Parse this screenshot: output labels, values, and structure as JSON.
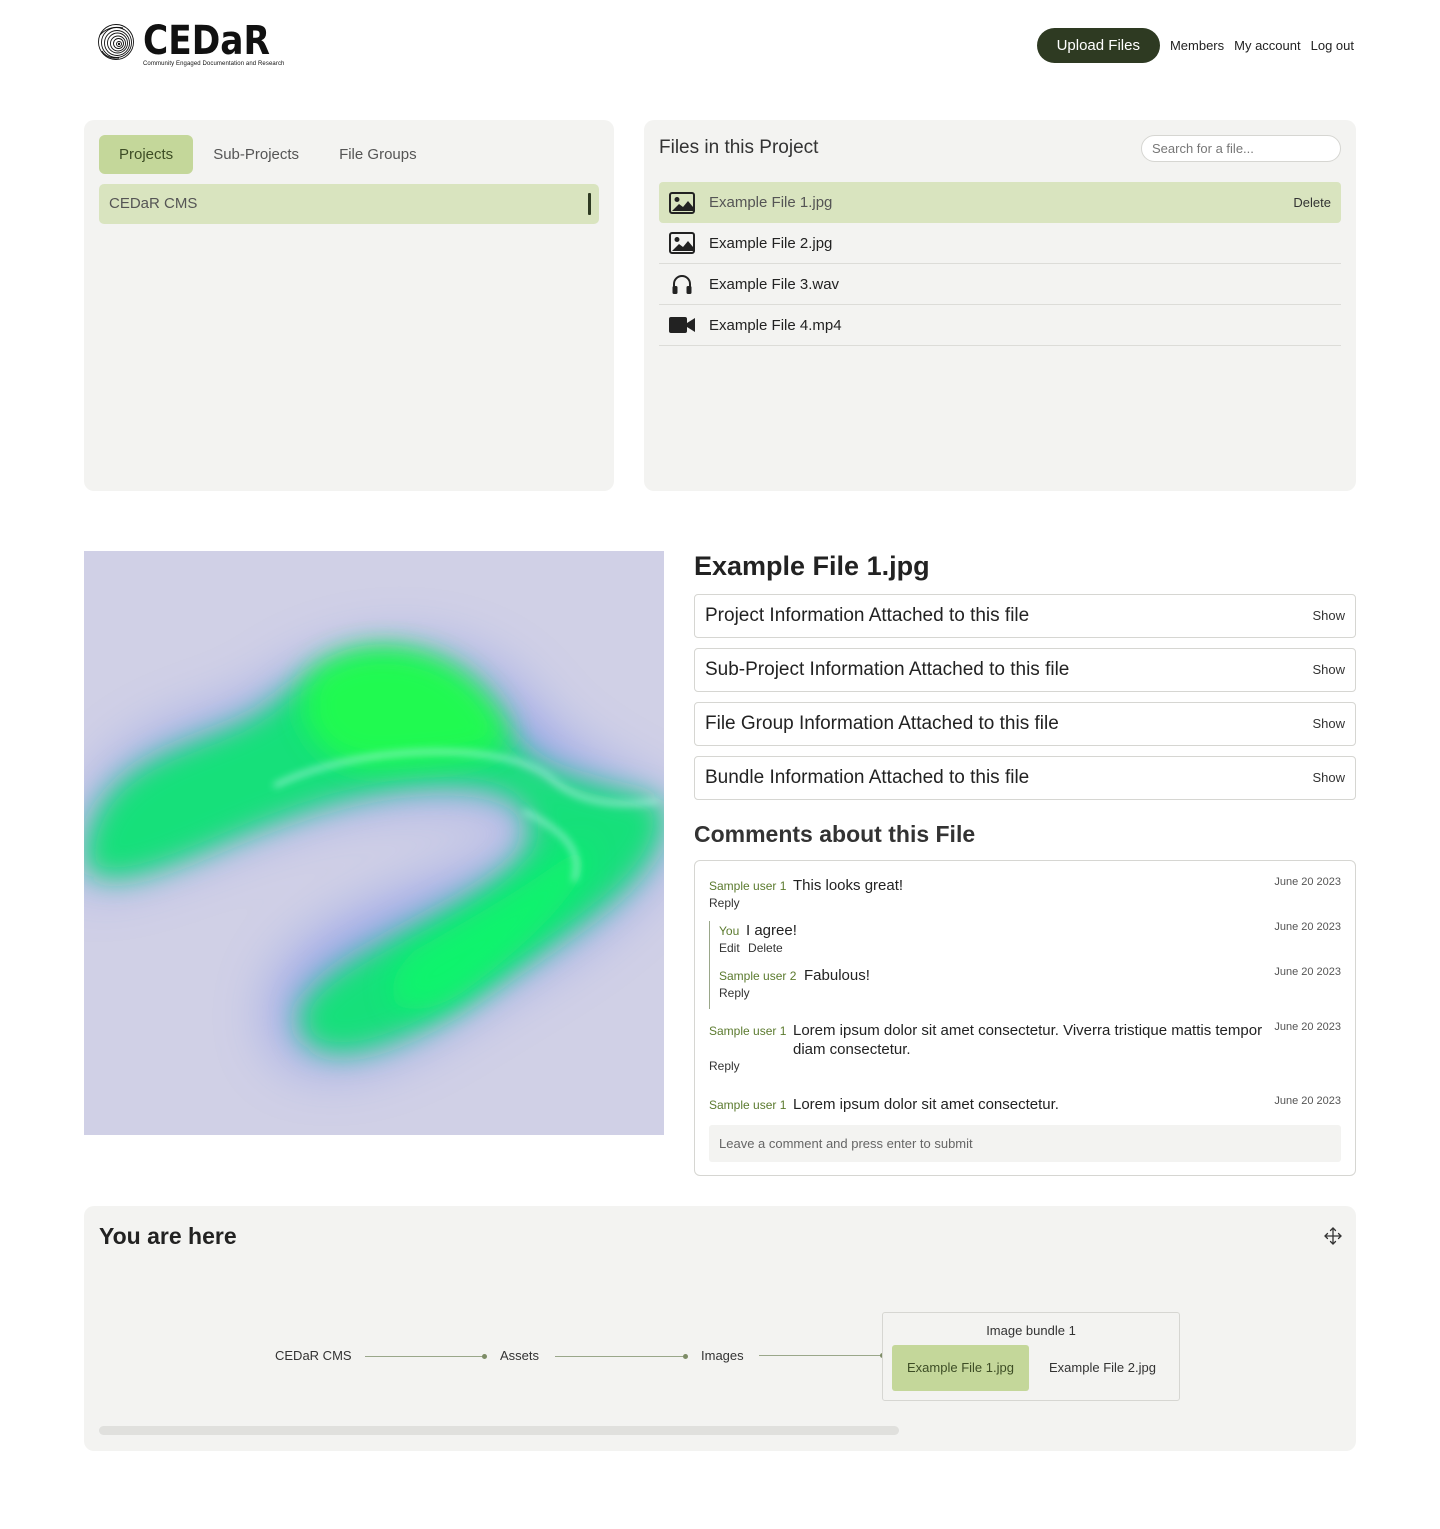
{
  "brand": {
    "name": "CEDaR",
    "tagline": "Community Engaged Documentation and Research",
    "logo_icon": "fingerprint-spiral-icon"
  },
  "nav": {
    "upload_label": "Upload Files",
    "links": [
      "Members",
      "My account",
      "Log out"
    ]
  },
  "left_panel": {
    "tabs": [
      "Projects",
      "Sub-Projects",
      "File Groups"
    ],
    "active_tab": "Projects",
    "projects": [
      "CEDaR CMS"
    ]
  },
  "files_panel": {
    "title": "Files in this Project",
    "search_placeholder": "Search for a file...",
    "delete_label": "Delete",
    "files": [
      {
        "name": "Example File 1.jpg",
        "icon": "image-icon",
        "selected": true
      },
      {
        "name": "Example File 2.jpg",
        "icon": "image-icon",
        "selected": false
      },
      {
        "name": "Example File 3.wav",
        "icon": "headphones-icon",
        "selected": false
      },
      {
        "name": "Example File 4.mp4",
        "icon": "video-camera-icon",
        "selected": false
      }
    ]
  },
  "detail": {
    "file_title": "Example File 1.jpg",
    "show_label": "Show",
    "sections": [
      "Project Information Attached to this file",
      "Sub-Project Information Attached to this file",
      "File Group Information Attached to this file",
      "Bundle Information Attached to this file"
    ]
  },
  "comments": {
    "title": "Comments about this File",
    "input_placeholder": "Leave a comment and press enter to submit",
    "items": [
      {
        "user": "Sample user 1",
        "text": "This looks great!",
        "date": "June 20 2023",
        "actions": [
          "Reply"
        ]
      },
      {
        "user": "You",
        "text": "I agree!",
        "date": "June 20 2023",
        "actions": [
          "Edit",
          "Delete"
        ]
      },
      {
        "user": "Sample user 2",
        "text": "Fabulous!",
        "date": "June 20 2023",
        "actions": [
          "Reply"
        ]
      },
      {
        "user": "Sample user 1",
        "text": "Lorem ipsum dolor sit amet consectetur. Viverra tristique mattis tempor diam consectetur.",
        "date": "June 20 2023",
        "actions": [
          "Reply"
        ]
      },
      {
        "user": "Sample user 1",
        "text": "Lorem ipsum dolor sit amet consectetur.",
        "date": "June 20 2023",
        "actions": []
      }
    ]
  },
  "location": {
    "title": "You are here",
    "path": [
      "CEDaR CMS",
      "Assets",
      "Images"
    ],
    "bundle": {
      "title": "Image bundle 1",
      "items": [
        "Example File 1.jpg",
        "Example File 2.jpg"
      ],
      "active": "Example File 1.jpg"
    }
  },
  "colors": {
    "accent_dark": "#2e3a22",
    "accent_light": "#c4d79a",
    "selected_row": "#d9e4bf",
    "panel_bg": "#f3f3f1",
    "username": "#5b7a2e"
  }
}
